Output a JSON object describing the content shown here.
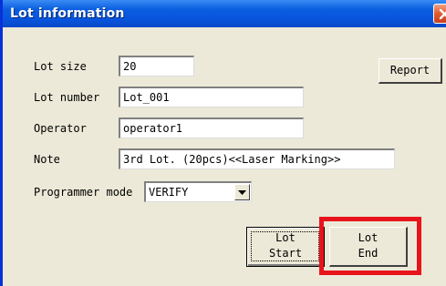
{
  "window": {
    "title": "Lot information"
  },
  "fields": {
    "lot_size": {
      "label": "Lot size",
      "value": "20"
    },
    "lot_number": {
      "label": "Lot number",
      "value": "Lot_001"
    },
    "operator": {
      "label": "Operator",
      "value": "operator1"
    },
    "note": {
      "label": "Note",
      "value": "3rd Lot. (20pcs)<<Laser Marking>>"
    },
    "programmer_mode": {
      "label": "Programmer mode",
      "selected": "VERIFY"
    }
  },
  "buttons": {
    "report": "Report",
    "lot_start": [
      "Lot",
      "Start"
    ],
    "lot_end": [
      "Lot",
      "End"
    ]
  },
  "colors": {
    "highlight": "#e8141c",
    "titlebar": "#0855dd",
    "dialog_bg": "#ece9d8"
  }
}
